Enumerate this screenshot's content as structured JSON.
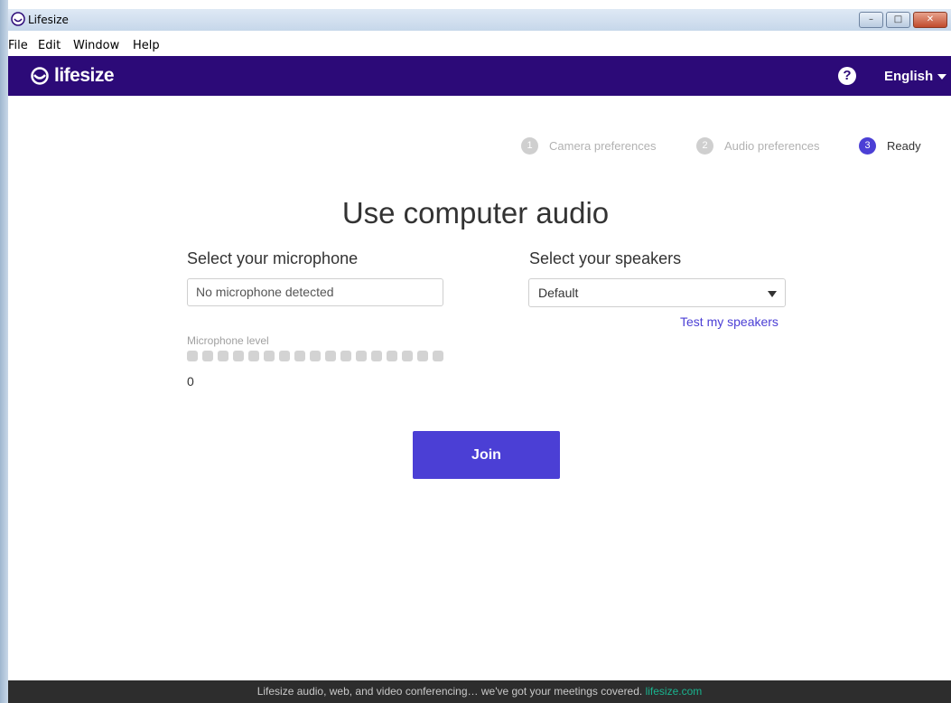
{
  "window": {
    "title": "Lifesize",
    "controls": {
      "minimize": "–",
      "maximize": "□",
      "close": "✕"
    }
  },
  "menu": [
    "File",
    "Edit",
    "Window",
    "Help"
  ],
  "header": {
    "logo": "lifesize",
    "help": "?",
    "language": "English"
  },
  "steps": [
    {
      "number": "1",
      "label": "Camera preferences",
      "state": "done"
    },
    {
      "number": "2",
      "label": "Audio preferences",
      "state": "done"
    },
    {
      "number": "3",
      "label": "Ready",
      "state": "active"
    }
  ],
  "main": {
    "heading": "Use computer audio",
    "microphone": {
      "label": "Select your microphone",
      "value": "No microphone detected",
      "level_label": "Microphone level",
      "level_segments": 17,
      "level_value": "0"
    },
    "speakers": {
      "label": "Select your speakers",
      "value": "Default",
      "test_link": "Test my speakers"
    },
    "join_label": "Join"
  },
  "footer": {
    "text": "Lifesize audio, web, and video conferencing… we've got your meetings covered.",
    "link": "lifesize.com"
  },
  "colors": {
    "header_bg": "#2c0a78",
    "accent": "#4b3fd5",
    "footer_bg": "#2d2d2d",
    "footer_link": "#19b38e"
  }
}
